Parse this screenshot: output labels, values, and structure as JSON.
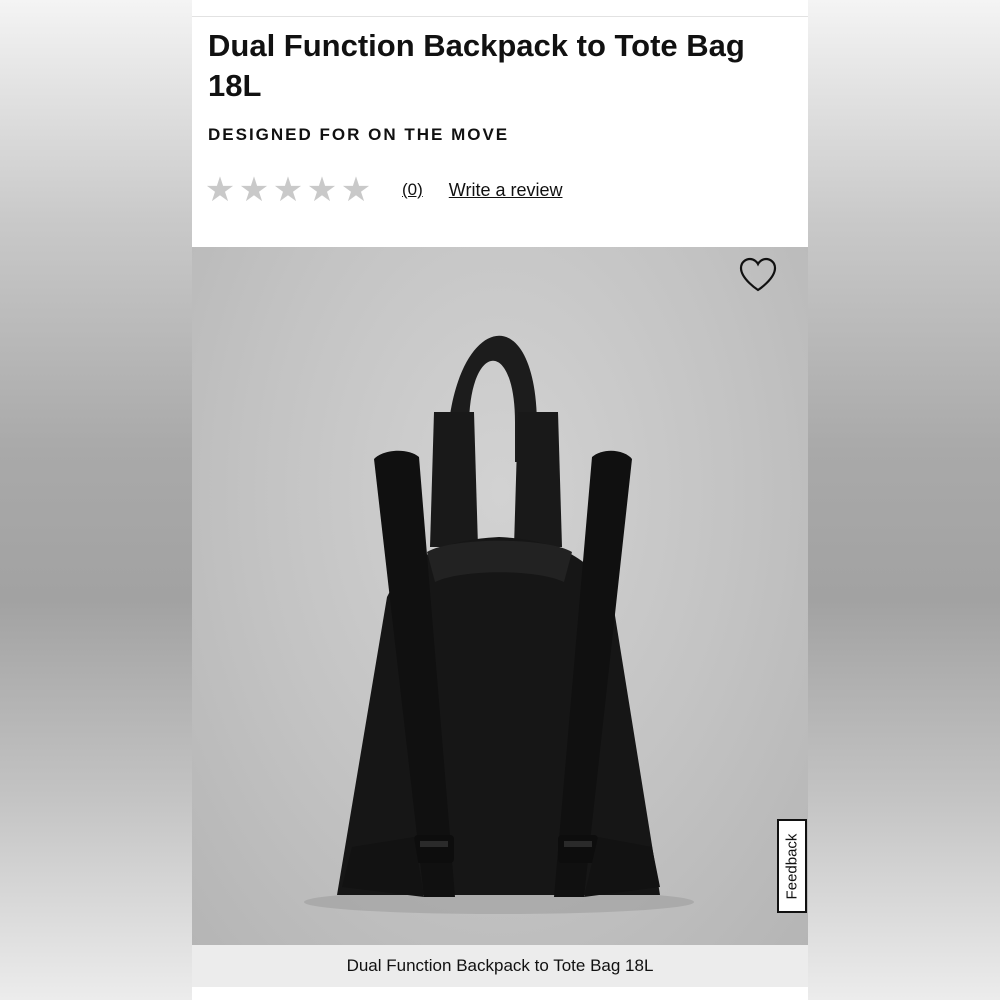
{
  "product": {
    "title": "Dual Function Backpack to Tote Bag 18L",
    "tagline": "DESIGNED FOR ON THE MOVE",
    "rating": {
      "stars_filled": 0,
      "stars_total": 5,
      "review_count": "(0)",
      "write_review_label": "Write a review"
    },
    "image_caption": "Dual Function Backpack to Tote Bag 18L"
  },
  "icons": {
    "wishlist": "heart-outline-icon",
    "rating_star": "star-icon"
  },
  "feedback": {
    "label": "Feedback"
  },
  "colors": {
    "star_empty": "#c9c9c9",
    "text": "#111111",
    "bag": "#1a1a1a"
  }
}
